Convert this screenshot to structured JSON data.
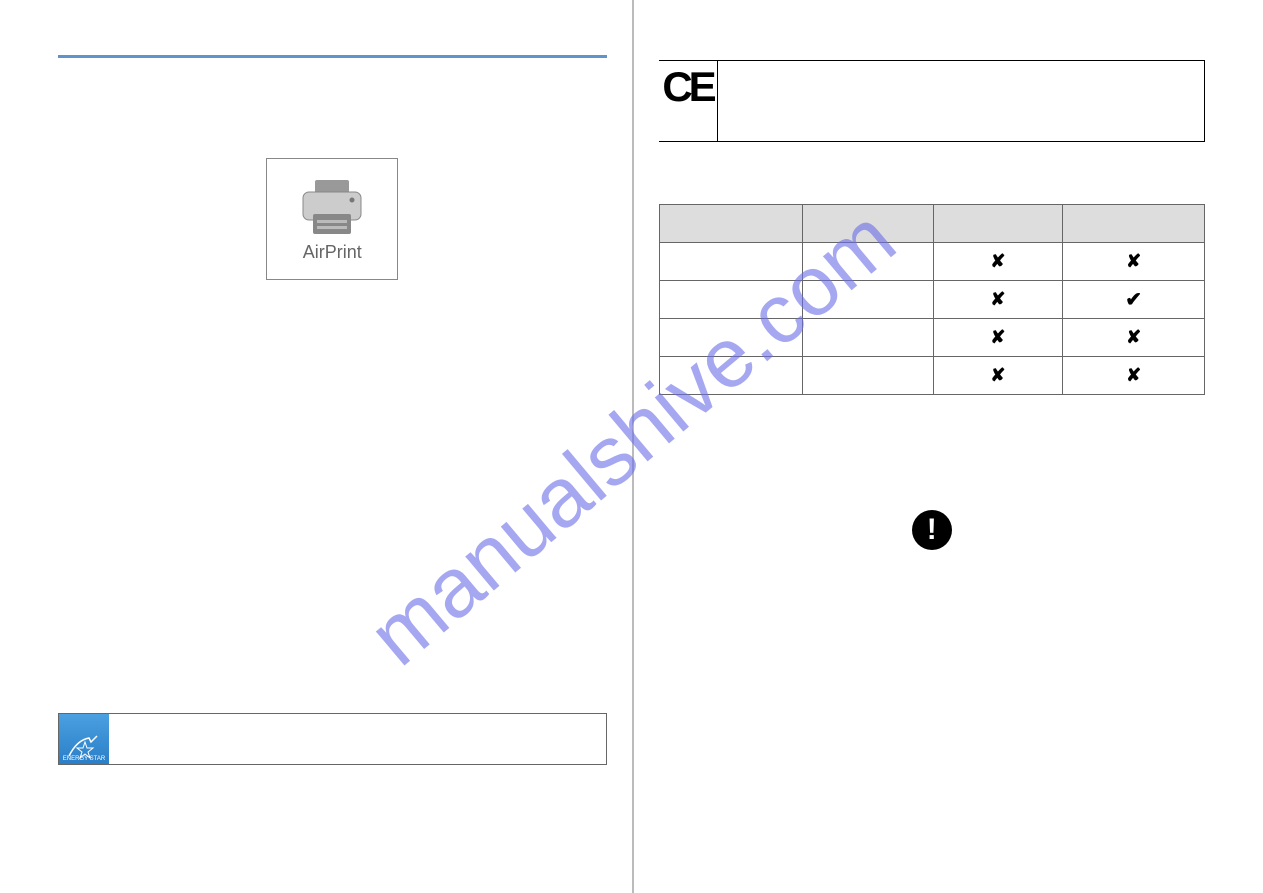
{
  "watermark": "manualshive.com",
  "airprint_label": "AirPrint",
  "energy_star_text": "ENERGY STAR",
  "ce_mark": "CE",
  "table": {
    "headers": [
      "",
      "",
      "",
      ""
    ],
    "rows": [
      {
        "c3": "✘",
        "c4": "✘"
      },
      {
        "c3": "✘",
        "c4": "✔"
      },
      {
        "c3": "✘",
        "c4": "✘"
      },
      {
        "c3": "✘",
        "c4": "✘"
      }
    ]
  },
  "exclamation": "!"
}
